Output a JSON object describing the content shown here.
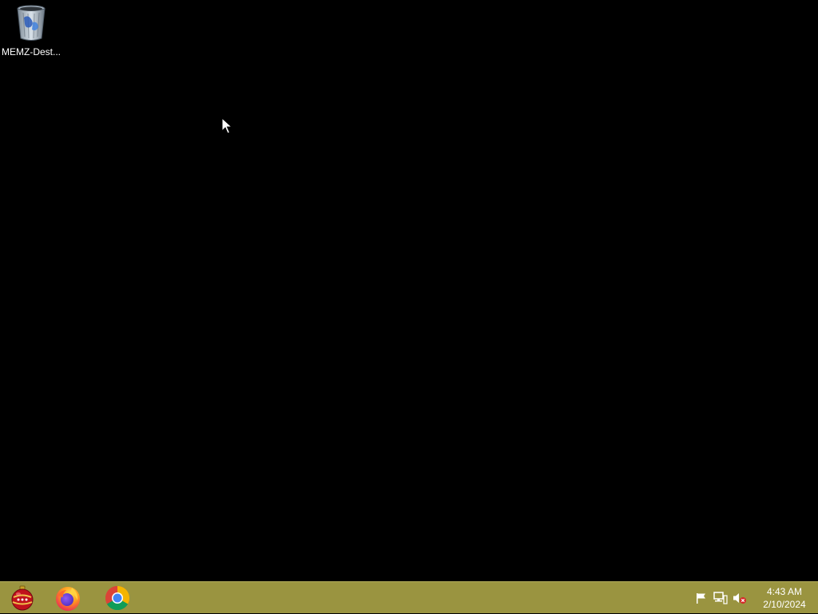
{
  "desktop": {
    "background_color": "#000000",
    "icons": [
      {
        "label": "MEMZ-Dest...",
        "icon": "recycle-bin-icon"
      }
    ]
  },
  "taskbar": {
    "color": "#9a9440",
    "pinned": [
      {
        "name": "start-orb",
        "icon": "christmas-ornament-icon"
      },
      {
        "name": "firefox",
        "icon": "firefox-icon"
      },
      {
        "name": "chrome",
        "icon": "chrome-icon"
      }
    ],
    "tray": {
      "icons": [
        "flag-icon",
        "network-icon",
        "volume-muted-icon"
      ],
      "time": "4:43 AM",
      "date": "2/10/2024"
    }
  }
}
